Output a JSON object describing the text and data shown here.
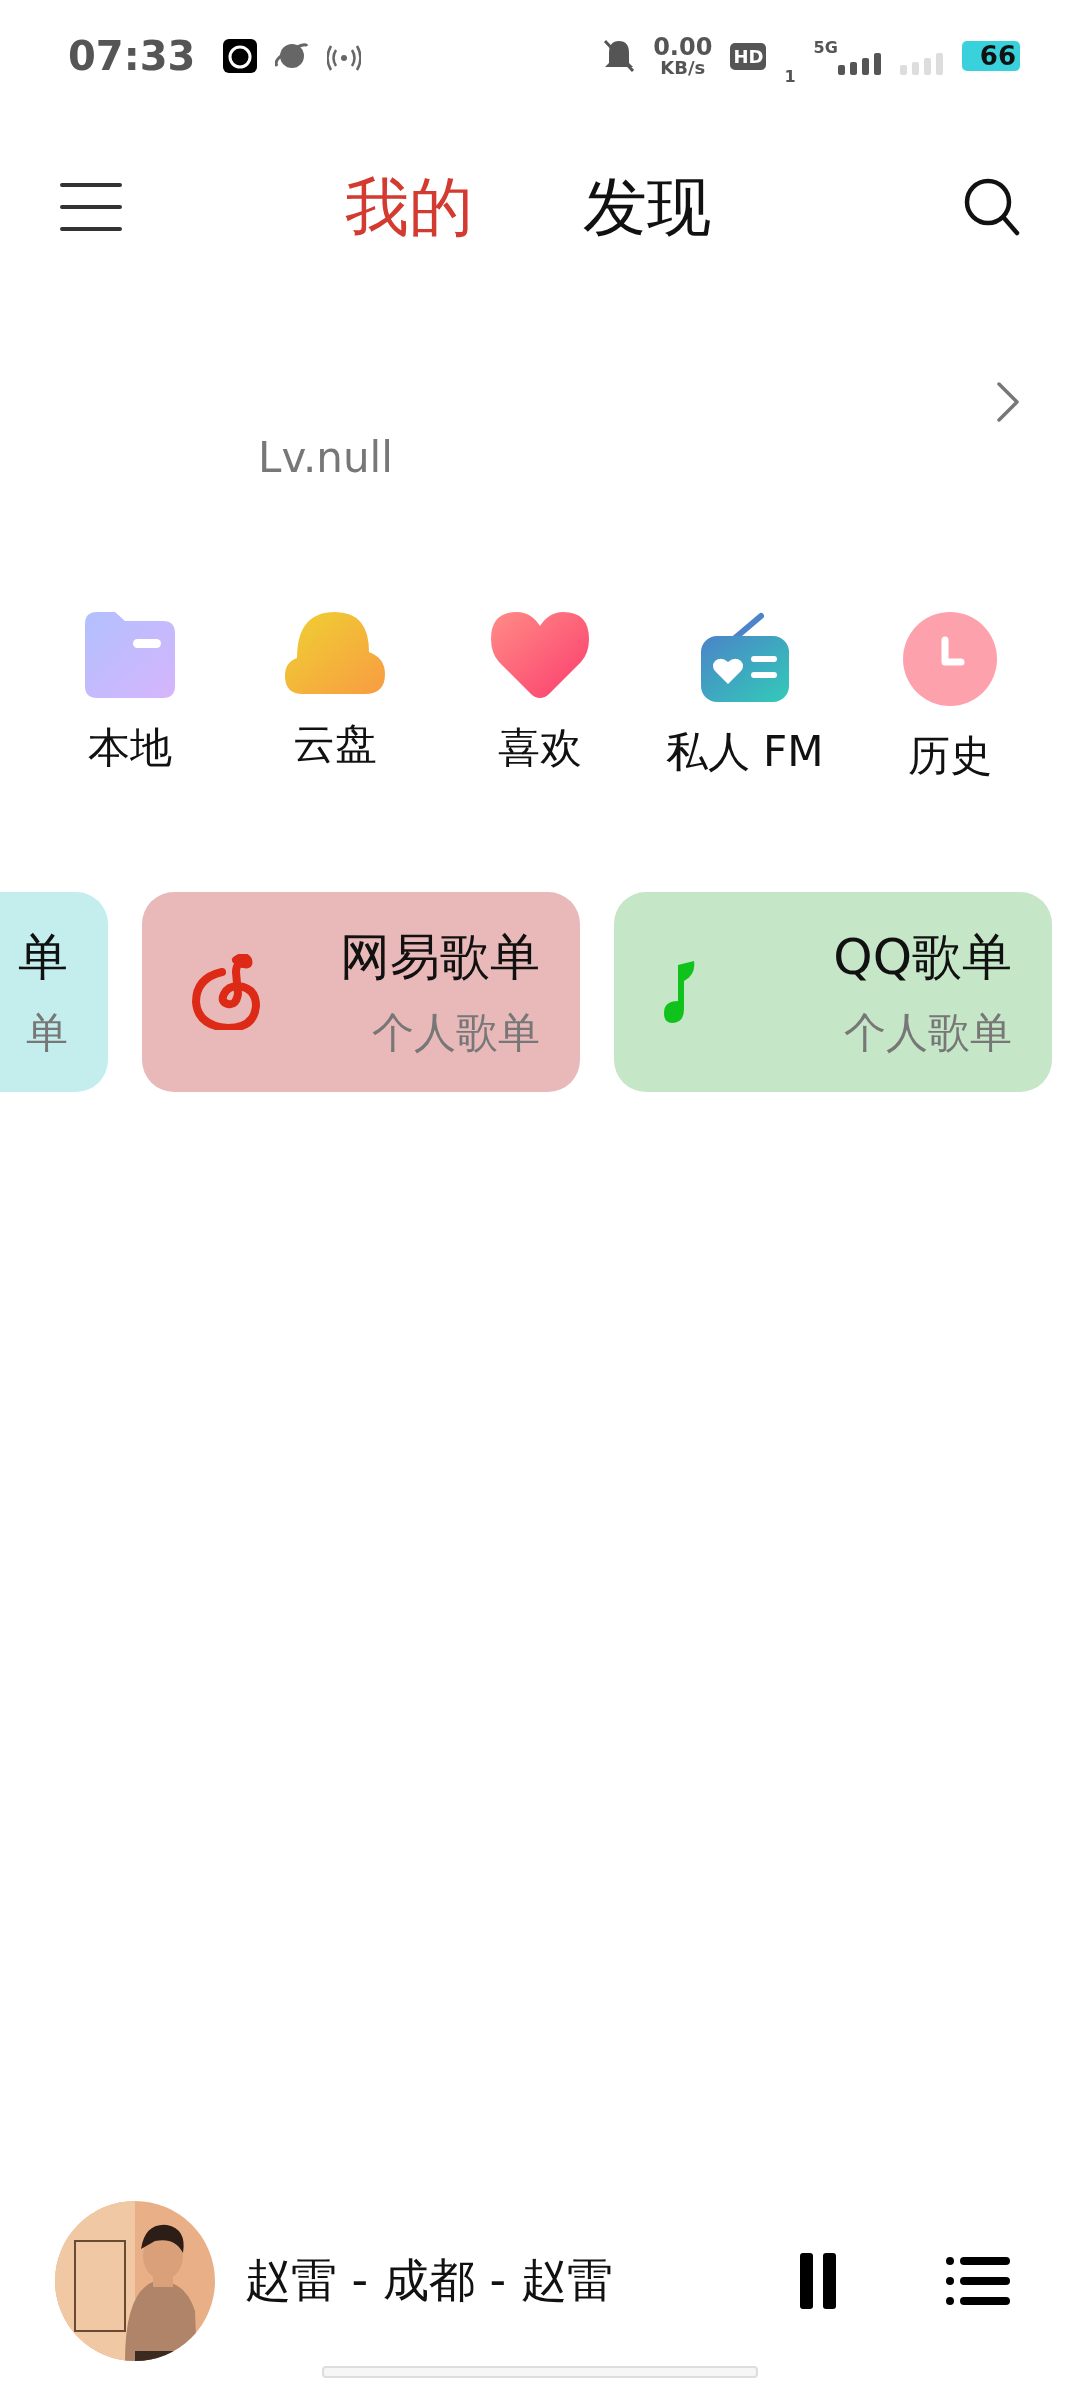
{
  "status_bar": {
    "time": "07:33",
    "speed_value": "0.00",
    "speed_unit": "KB/s",
    "hd": "HD",
    "hd_sub": "1",
    "network": "5G",
    "battery": "66"
  },
  "header": {
    "tabs": [
      {
        "label": "我的",
        "selected": true
      },
      {
        "label": "发现",
        "selected": false
      }
    ]
  },
  "profile": {
    "level": "Lv.null"
  },
  "shortcuts": [
    {
      "kind": "folder",
      "label": "本地"
    },
    {
      "kind": "cloud",
      "label": "云盘"
    },
    {
      "kind": "heart",
      "label": "喜欢"
    },
    {
      "kind": "radio",
      "label": "私人 FM"
    },
    {
      "kind": "clock",
      "label": "历史"
    }
  ],
  "playlist_cards": [
    {
      "kind": "partial",
      "title": "单",
      "subtitle": "单",
      "color": "#c4eeee"
    },
    {
      "kind": "netease",
      "title": "网易歌单",
      "subtitle": "个人歌单",
      "color": "#e9b9b9"
    },
    {
      "kind": "qq",
      "title": "QQ歌单",
      "subtitle": "个人歌单",
      "color": "#c6e6c8"
    }
  ],
  "player": {
    "track": "赵雷 - 成都 - 赵雷",
    "playing": true
  }
}
